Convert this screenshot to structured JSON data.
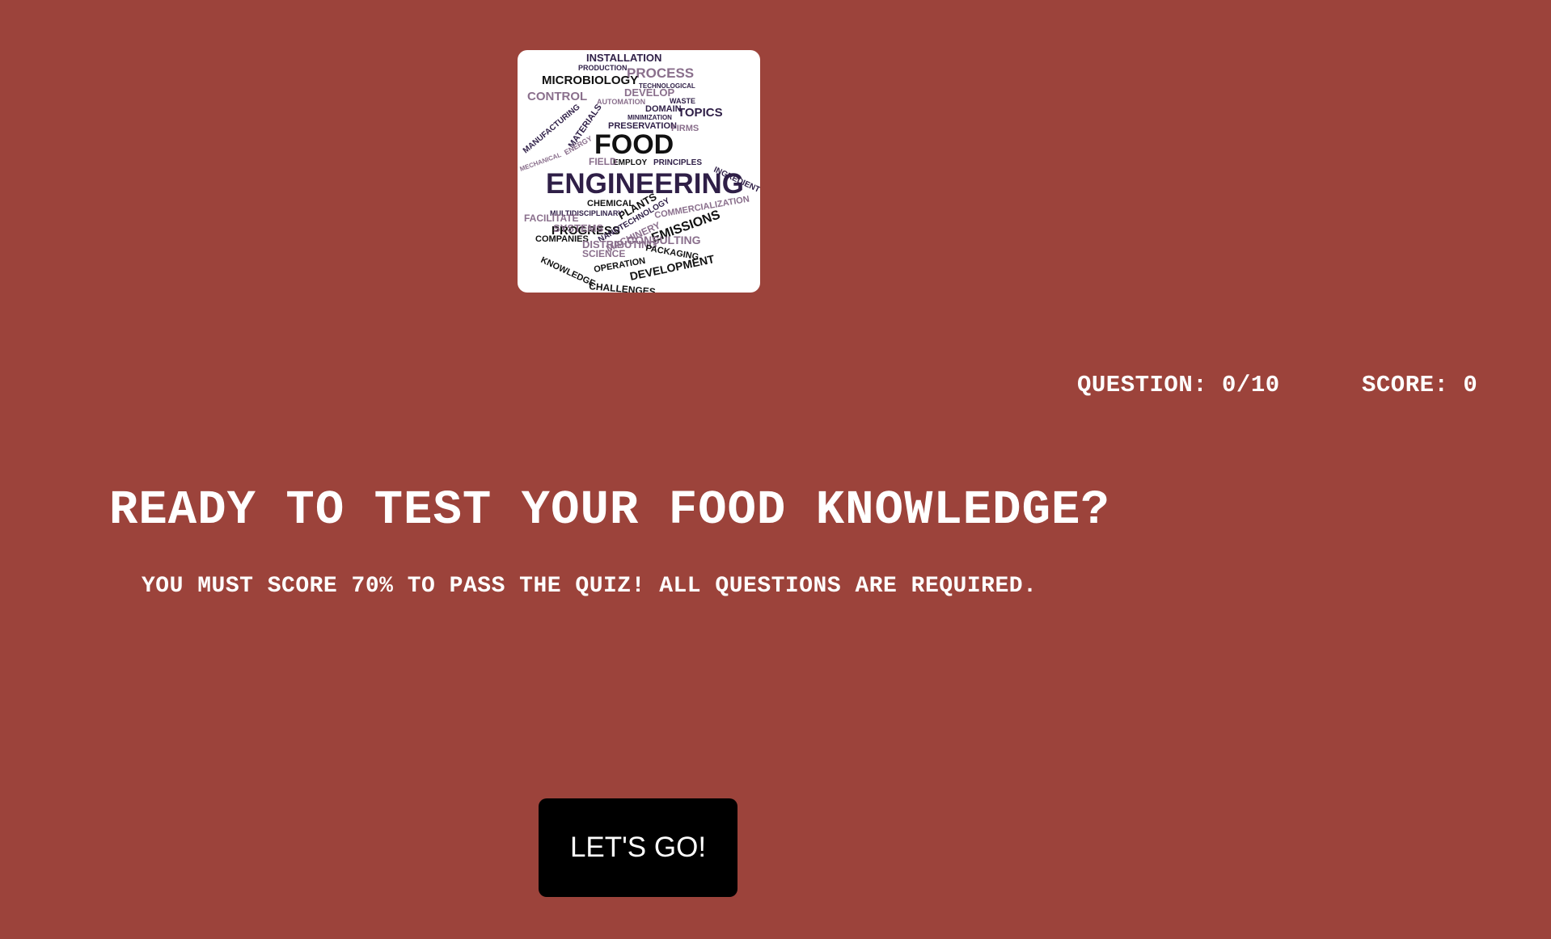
{
  "logo": {
    "words": [
      "INSTALLATION",
      "PRODUCTION",
      "PROCESS",
      "MICROBIOLOGY",
      "TECHNOLOGICAL",
      "CONTROL",
      "DEVELOP",
      "AUTOMATION",
      "WASTE",
      "DOMAIN",
      "TOPICS",
      "MINIMIZATION",
      "MANUFACTURING",
      "MATERIALS",
      "PRESERVATION",
      "FIRMS",
      "FOOD",
      "EMPLOY",
      "PRINCIPLES",
      "FIELD",
      "ENGINEERING",
      "INGREDIENT",
      "CHEMICAL",
      "PLANTS",
      "COMMERCIALIZATION",
      "MULTIDISCIPLINARY",
      "PROGRESS",
      "NANOTECHNOLOGY",
      "EMISSIONS",
      "FACILITATE",
      "MACHINERY",
      "SYSTEMS",
      "COMPANIES",
      "DISTRIBUTING",
      "CONSULTING",
      "KNOWLEDGE",
      "SCIENCE",
      "PACKAGING",
      "OPERATION",
      "DEVELOPMENT",
      "CHALLENGES",
      "ENERGY",
      "MECHANICAL"
    ]
  },
  "status": {
    "question_label": "QUESTION: 0/10",
    "score_label": "SCORE: 0"
  },
  "intro": {
    "heading": "READY TO TEST YOUR FOOD KNOWLEDGE?",
    "subheading": "YOU MUST SCORE 70% TO PASS THE QUIZ! ALL QUESTIONS ARE REQUIRED."
  },
  "start_button": {
    "label": "LET'S GO!"
  },
  "colors": {
    "background": "#9c433b",
    "text": "#ffffff",
    "button": "#000000",
    "logo_dark": "#2f1f47",
    "logo_light": "#8a6f8c"
  }
}
